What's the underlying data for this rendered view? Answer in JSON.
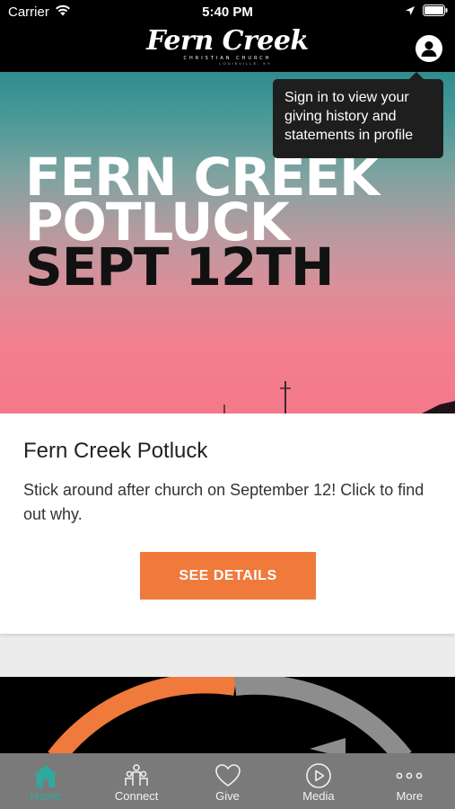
{
  "status_bar": {
    "carrier": "Carrier",
    "time": "5:40 PM"
  },
  "header": {
    "logo_main": "Fern Creek",
    "logo_sub": "CHRISTIAN CHURCH",
    "logo_sub2": "LOUISVILLE, KY"
  },
  "tooltip": {
    "text": "Sign in to view your giving history and statements in profile"
  },
  "hero": {
    "line1": "FERN CREEK",
    "line2": "POTLUCK",
    "line3": "SEPT 12TH"
  },
  "card": {
    "title": "Fern Creek Potluck",
    "description": "Stick around after church on September 12! Click to find out why.",
    "button_label": "SEE DETAILS"
  },
  "tabs": [
    {
      "label": "Home",
      "icon": "home-icon",
      "active": true
    },
    {
      "label": "Connect",
      "icon": "people-icon",
      "active": false
    },
    {
      "label": "Give",
      "icon": "heart-icon",
      "active": false
    },
    {
      "label": "Media",
      "icon": "play-icon",
      "active": false
    },
    {
      "label": "More",
      "icon": "more-icon",
      "active": false
    }
  ],
  "colors": {
    "accent": "#f0793c",
    "active_tab": "#2fa9a0",
    "tab_bar": "#7a7a7a"
  }
}
